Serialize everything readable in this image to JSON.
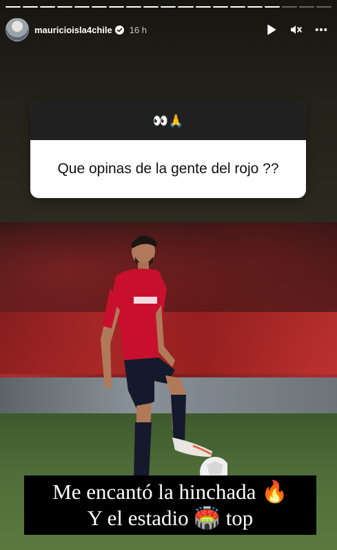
{
  "story": {
    "progress_segments": 19,
    "completed_segments": 16
  },
  "header": {
    "username": "mauricioisla4chile",
    "time": "16 h",
    "verified": true,
    "icons": [
      "play-icon",
      "mute-icon",
      "more-icon"
    ]
  },
  "question": {
    "emoji": "👀🙏",
    "text": "Que opinas de la gente del rojo ??"
  },
  "caption": {
    "line1": "Me encantó la hinchada 🔥",
    "line2": "Y el estadio 🏟️ top"
  },
  "colors": {
    "question_header": "#202020",
    "question_body": "#ffffff",
    "caption_bg": "#000000",
    "jersey_red": "#c8102e"
  }
}
